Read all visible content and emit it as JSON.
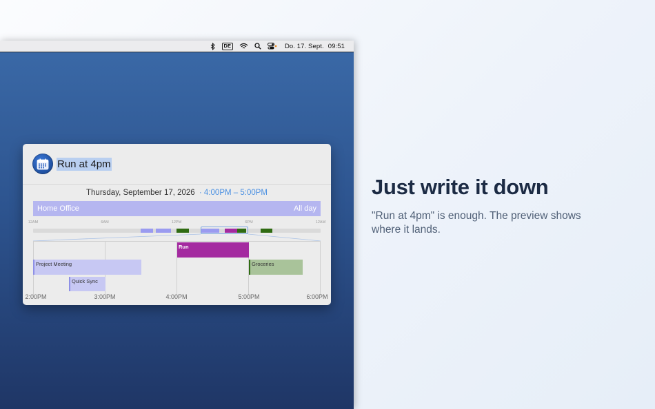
{
  "menubar": {
    "input_source": "DE",
    "date": "Do. 17. Sept.",
    "time": "09:51"
  },
  "popup": {
    "query": "Run at 4pm",
    "date": "Thursday, September 17, 2026",
    "time_range": "· 4:00PM – 5:00PM",
    "allday_event": {
      "title": "Home Office",
      "label": "All day",
      "color": "#b5b6f0"
    },
    "overview_labels": [
      "12AM",
      "6AM",
      "12PM",
      "6PM",
      "12AM"
    ],
    "hour_labels": [
      "2:00PM",
      "3:00PM",
      "4:00PM",
      "5:00PM",
      "6:00PM"
    ],
    "events": [
      {
        "title": "Run",
        "start": "4:00PM",
        "end": "5:00PM",
        "color": "#a42aa0"
      },
      {
        "title": "Project Meeting",
        "start": "2:00PM",
        "end": "3:30PM",
        "color": "#c7c8f3"
      },
      {
        "title": "Quick Sync",
        "start": "2:30PM",
        "end": "3:00PM",
        "color": "#c7c8f3"
      },
      {
        "title": "Groceries",
        "start": "5:00PM",
        "end": "5:45PM",
        "color": "#a9c39a"
      }
    ]
  },
  "promo": {
    "title": "Just write it down",
    "subtitle": "\"Run at 4pm\" is enough. The preview shows where it lands."
  }
}
